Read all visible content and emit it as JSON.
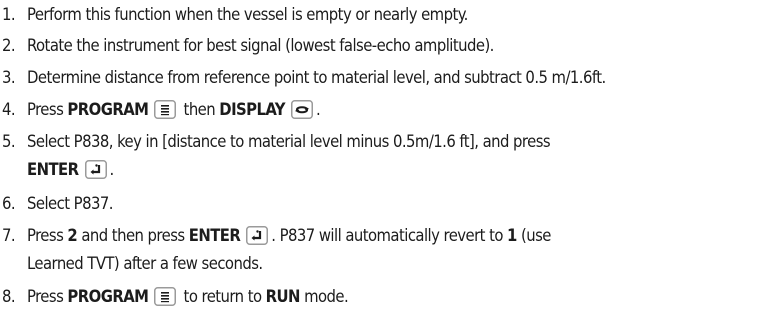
{
  "steps": [
    {
      "number": "1.",
      "text": "Perform this function when the vessel is empty or nearly empty."
    },
    {
      "number": "2.",
      "text": "Rotate the instrument for best signal (lowest false-echo amplitude)."
    },
    {
      "number": "3.",
      "text": "Determine distance from reference point to material level, and subtract 0.5 m/1.6ft."
    },
    {
      "number": "4.",
      "pre": "Press ",
      "key1": "PROGRAM",
      "mid": " then ",
      "key2": "DISPLAY",
      "post": "."
    },
    {
      "number": "5.",
      "line1": "Select P838, key in [distance to material level minus 0.5m/1.6 ft], and press",
      "key": "ENTER",
      "post": "."
    },
    {
      "number": "6.",
      "text": "Select P837."
    },
    {
      "number": "7.",
      "pre": "Press ",
      "value": "2",
      "mid": " and then press ",
      "key": "ENTER",
      "post": ". P837 will automatically revert to ",
      "value2": "1",
      "post2": " (use",
      "line2": "Learned TVT) after a few seconds."
    },
    {
      "number": "8.",
      "pre": "Press ",
      "key": "PROGRAM",
      "mid": " to return to ",
      "mode": "RUN",
      "post": " mode."
    }
  ],
  "icons": {
    "program": "program-key-icon",
    "display": "display-key-icon",
    "enter": "enter-key-icon"
  },
  "colors": {
    "text": "#1c1c1c",
    "key_border": "#9a9a9a",
    "key_fill": "#ffffff"
  }
}
